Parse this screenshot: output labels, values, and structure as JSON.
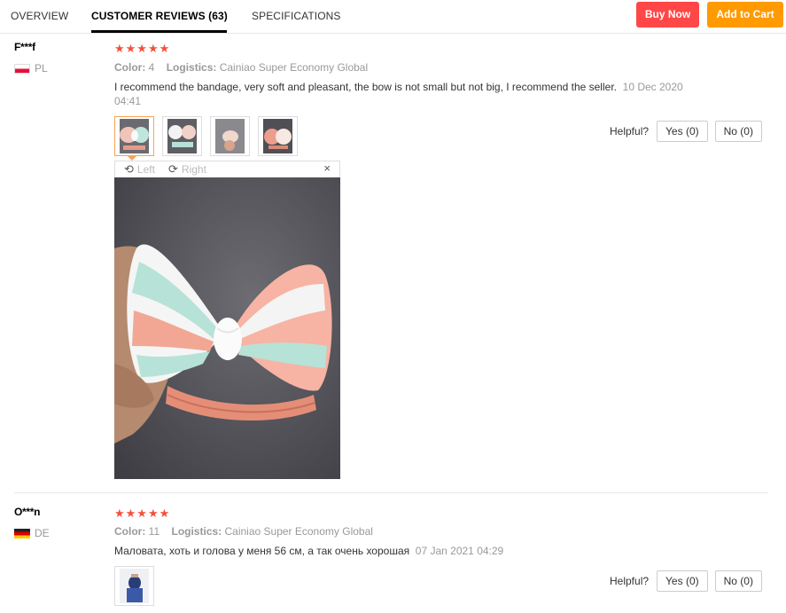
{
  "tabs": {
    "overview": "OVERVIEW",
    "reviews": "CUSTOMER REVIEWS (63)",
    "specs": "SPECIFICATIONS"
  },
  "actions": {
    "buy_now": "Buy Now",
    "add_to_cart": "Add to Cart"
  },
  "colors": {
    "buy": "#ff4747",
    "cart": "#ff9a00",
    "star": "#f5503a"
  },
  "reviews": [
    {
      "user": "F***f",
      "country": "PL",
      "stars": "★★★★★",
      "rating": 5,
      "color_label": "Color:",
      "color_value": "4",
      "logistics_label": "Logistics:",
      "logistics_value": "Cainiao Super Economy Global",
      "text": "I recommend the bandage, very soft and pleasant, the bow is not small but not big, I recommend the seller.",
      "date": "10 Dec 2020 04:41",
      "helpful_label": "Helpful?",
      "yes": "Yes (0)",
      "no": "No (0)",
      "viewer": {
        "left": "Left",
        "right": "Right",
        "close": "×"
      }
    },
    {
      "user": "O***n",
      "country": "DE",
      "stars": "★★★★★",
      "rating": 5,
      "color_label": "Color:",
      "color_value": "11",
      "logistics_label": "Logistics:",
      "logistics_value": "Cainiao Super Economy Global",
      "text": "Маловата, хоть и голова у меня 56 см, а так очень хорошая",
      "date": "07 Jan 2021 04:29",
      "helpful_label": "Helpful?",
      "yes": "Yes (0)",
      "no": "No (0)"
    }
  ]
}
